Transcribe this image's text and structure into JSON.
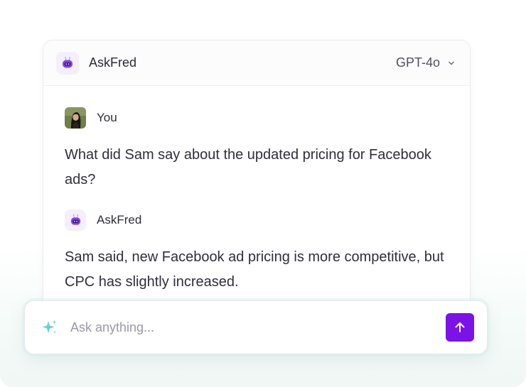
{
  "header": {
    "title": "AskFred",
    "model_selected": "GPT-4o",
    "bot_icon": "robot-icon"
  },
  "messages": [
    {
      "sender": "You",
      "avatar_icon": "user-photo",
      "text": "What did Sam say about the updated pricing for Facebook ads?"
    },
    {
      "sender": "AskFred",
      "avatar_icon": "robot-icon",
      "text": "Sam said, new Facebook ad pricing is more competitive, but CPC has slightly increased."
    }
  ],
  "composer": {
    "placeholder": "Ask anything...",
    "value": "",
    "sparkle_icon": "sparkle-icon",
    "send_icon": "arrow-up-icon"
  },
  "colors": {
    "accent": "#7b12e6",
    "bot_avatar_bg": "#f3effb",
    "text": "#2f2f3a"
  }
}
